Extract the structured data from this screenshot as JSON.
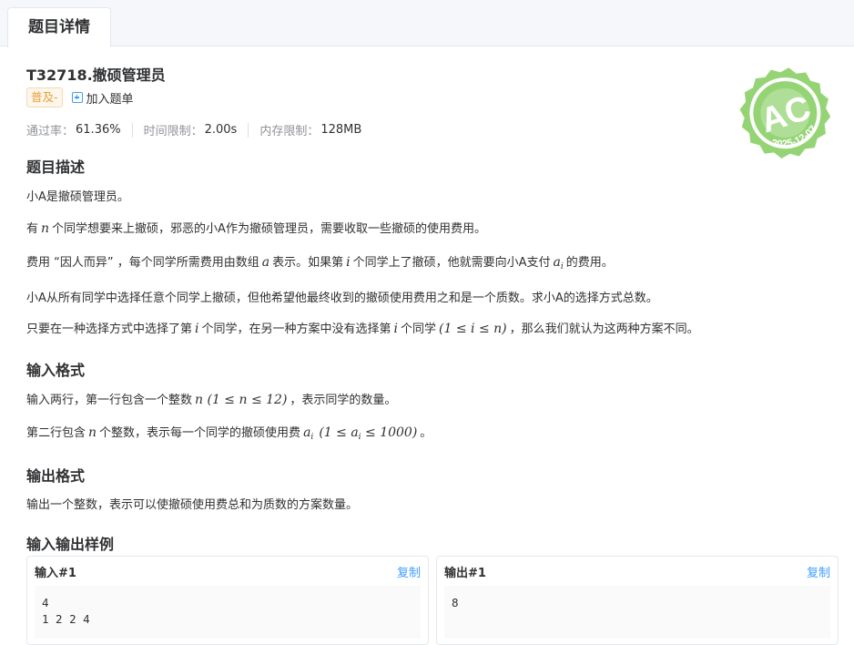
{
  "tab": {
    "label": "题目详情"
  },
  "problem": {
    "title": "T32718.撤硕管理员",
    "level": "普及-",
    "add_to_list": "加入题单",
    "stats": [
      {
        "label": "通过率：",
        "value": "61.36%"
      },
      {
        "label": "时间限制：",
        "value": "2.00s"
      },
      {
        "label": "内存限制：",
        "value": "128MB"
      }
    ]
  },
  "stamp": {
    "text": "AC",
    "date": "2025-12-07",
    "color": "#95d475"
  },
  "description": {
    "heading": "题目描述",
    "p1": "小A是撤硕管理员。",
    "p2": {
      "t1": "有",
      "m1": "n",
      "t2": "个同学想要来上撤硕，邪恶的小A作为撤硕管理员，需要收取一些撤硕的使用费用。"
    },
    "p3": {
      "t1": "费用 “因人而异” ，每个同学所需费用由数组",
      "m1": "a",
      "t2": "表示。如果第",
      "m2": "i",
      "t3": "个同学上了撤硕，他就需要向小A支付",
      "m3": "a",
      "m3sub": "i",
      "t4": "的费用。"
    },
    "p4": "小A从所有同学中选择任意个同学上撤硕，但他希望他最终收到的撤硕使用费用之和是一个质数。求小A的选择方式总数。",
    "p5": {
      "t1": "只要在一种选择方式中选择了第",
      "m1": "i",
      "t2": "个同学，在另一种方案中没有选择第",
      "m2": "i",
      "t3": "个同学",
      "m3": "(1 ≤ i ≤ n)",
      "t4": "，那么我们就认为这两种方案不同。"
    }
  },
  "input_format": {
    "heading": "输入格式",
    "p1": {
      "t1": "输入两行，第一行包含一个整数",
      "m1": "n (1 ≤ n ≤ 12)",
      "t2": "，表示同学的数量。"
    },
    "p2": {
      "t1": "第二行包含",
      "m1": "n",
      "t2": "个整数，表示每一个同学的撤硕使用费",
      "m2": "a",
      "m2sub": "i",
      "m3": "(1 ≤ a",
      "m3sub": "i",
      "m4": "≤ 1000)",
      "t3": "。"
    }
  },
  "output_format": {
    "heading": "输出格式",
    "p1": "输出一个整数，表示可以使撤硕使用费总和为质数的方案数量。"
  },
  "samples": {
    "heading": "输入输出样例",
    "copy_label": "复制",
    "input": {
      "title": "输入#1",
      "content": "4\n1 2 2 4"
    },
    "output": {
      "title": "输出#1",
      "content": "8"
    }
  }
}
